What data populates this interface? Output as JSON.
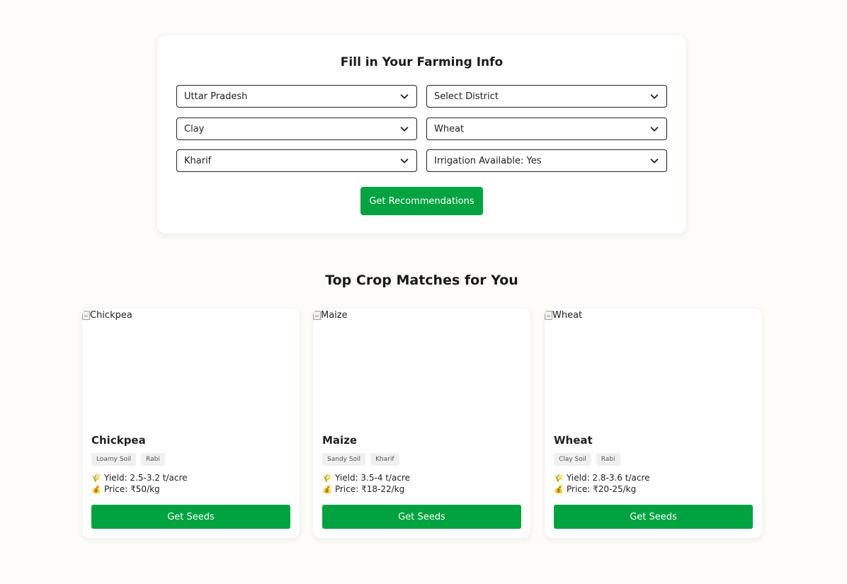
{
  "form": {
    "title": "Fill in Your Farming Info",
    "state": "Uttar Pradesh",
    "district": "Select District",
    "soil": "Clay",
    "crop": "Wheat",
    "season": "Kharif",
    "irrigation": "Irrigation Available: Yes",
    "button": "Get Recommendations"
  },
  "results": {
    "title": "Top Crop Matches for You",
    "crops": [
      {
        "img_alt": "Chickpea",
        "name": "Chickpea",
        "tags": [
          "Loamy Soil",
          "Rabi"
        ],
        "yield_icon": "🌾",
        "yield": "Yield: 2.5-3.2 t/acre",
        "price_icon": "💰",
        "price": "Price: ₹50/kg",
        "button": "Get Seeds"
      },
      {
        "img_alt": "Maize",
        "name": "Maize",
        "tags": [
          "Sandy Soil",
          "Kharif"
        ],
        "yield_icon": "🌾",
        "yield": "Yield: 3.5-4 t/acre",
        "price_icon": "💰",
        "price": "Price: ₹18-22/kg",
        "button": "Get Seeds"
      },
      {
        "img_alt": "Wheat",
        "name": "Wheat",
        "tags": [
          "Clay Soil",
          "Rabi"
        ],
        "yield_icon": "🌾",
        "yield": "Yield: 2.8-3.6 t/acre",
        "price_icon": "💰",
        "price": "Price: ₹20-25/kg",
        "button": "Get Seeds"
      }
    ]
  },
  "colors": {
    "accent": "#00a33f",
    "background": "#fdfcf8"
  },
  "icons": {
    "select_arrow": "chevron-down-icon",
    "broken_image": "broken-image-icon"
  }
}
